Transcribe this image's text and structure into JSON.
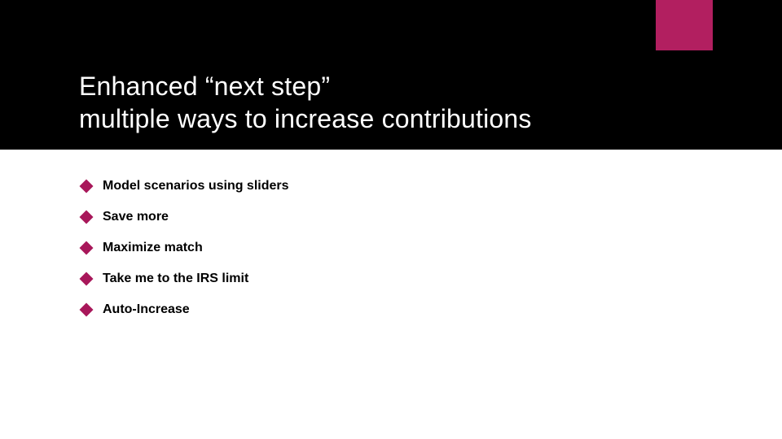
{
  "title_line1": "Enhanced “next step”",
  "title_line2": "multiple ways to increase contributions",
  "bullets": [
    "Model scenarios using sliders",
    "Save more",
    "Maximize match",
    "Take me to the IRS limit",
    "Auto-Increase"
  ]
}
